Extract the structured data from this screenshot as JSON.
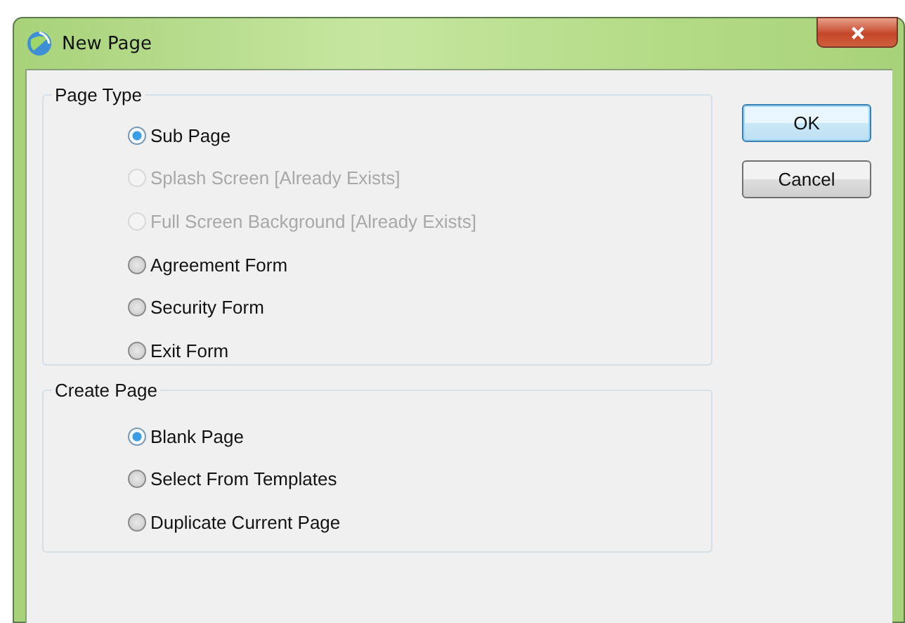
{
  "window": {
    "title": "New Page"
  },
  "groups": [
    {
      "title": "Page Type",
      "options": [
        {
          "label": "Sub Page",
          "selected": true,
          "disabled": false
        },
        {
          "label": "Splash Screen [Already Exists]",
          "selected": false,
          "disabled": true
        },
        {
          "label": "Full Screen Background [Already Exists]",
          "selected": false,
          "disabled": true
        },
        {
          "label": "Agreement Form",
          "selected": false,
          "disabled": false
        },
        {
          "label": "Security Form",
          "selected": false,
          "disabled": false
        },
        {
          "label": "Exit Form",
          "selected": false,
          "disabled": false
        }
      ]
    },
    {
      "title": "Create Page",
      "options": [
        {
          "label": "Blank Page",
          "selected": true,
          "disabled": false
        },
        {
          "label": "Select From Templates",
          "selected": false,
          "disabled": false
        },
        {
          "label": "Duplicate Current Page",
          "selected": false,
          "disabled": false
        }
      ]
    }
  ],
  "buttons": [
    {
      "label": "OK",
      "default": true
    },
    {
      "label": "Cancel",
      "default": false
    }
  ]
}
